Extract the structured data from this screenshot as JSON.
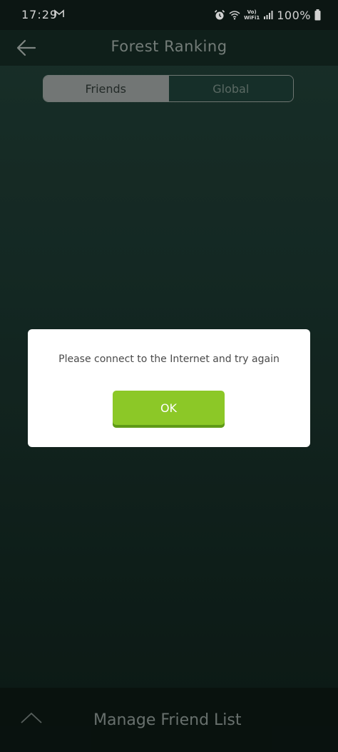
{
  "status_bar": {
    "time": "17:29",
    "battery": "100%",
    "volte_label": "Vo)",
    "wifi_label": "WiFi1"
  },
  "app_bar": {
    "title": "Forest Ranking"
  },
  "tabs": [
    {
      "label": "Friends",
      "selected": true
    },
    {
      "label": "Global",
      "selected": false
    }
  ],
  "dialog": {
    "message": "Please connect to the Internet and try again",
    "ok_label": "OK"
  },
  "bottom_bar": {
    "label": "Manage Friend List"
  },
  "colors": {
    "accent": "#8cc827",
    "background": "#1f3a32"
  }
}
